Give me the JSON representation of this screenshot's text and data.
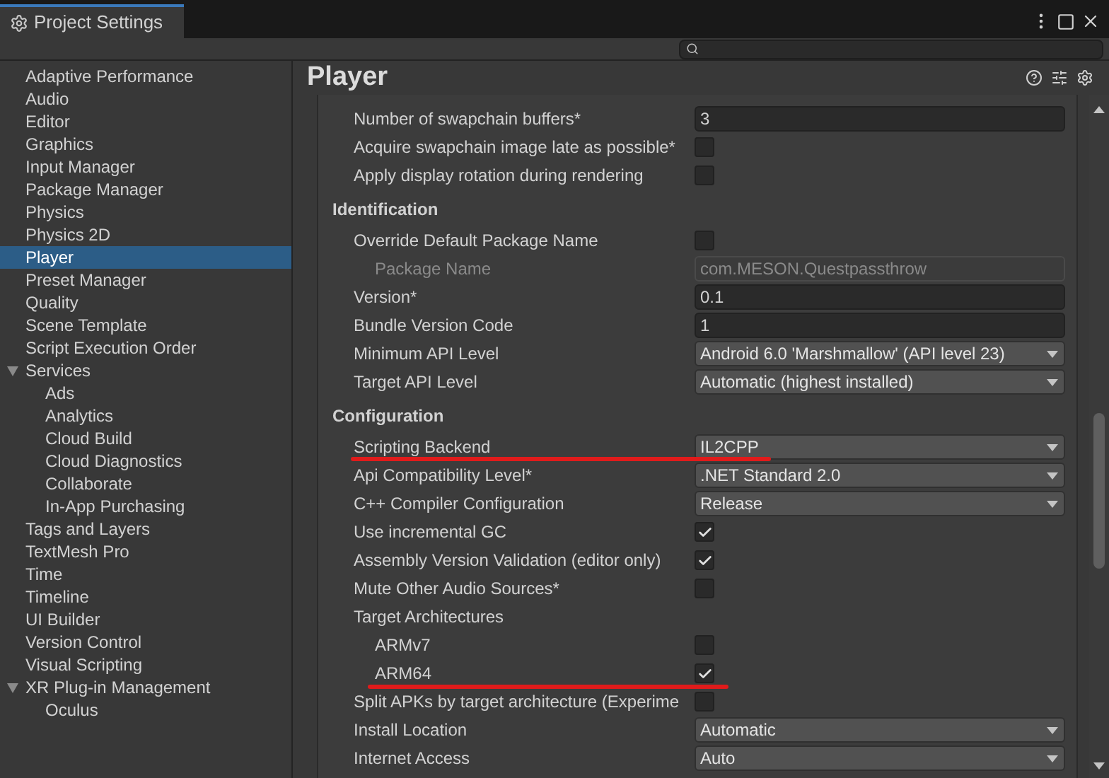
{
  "window": {
    "tab_title": "Project Settings"
  },
  "sidebar": {
    "items": [
      {
        "label": "Adaptive Performance",
        "selected": false
      },
      {
        "label": "Audio",
        "selected": false
      },
      {
        "label": "Editor",
        "selected": false
      },
      {
        "label": "Graphics",
        "selected": false
      },
      {
        "label": "Input Manager",
        "selected": false
      },
      {
        "label": "Package Manager",
        "selected": false
      },
      {
        "label": "Physics",
        "selected": false
      },
      {
        "label": "Physics 2D",
        "selected": false
      },
      {
        "label": "Player",
        "selected": true
      },
      {
        "label": "Preset Manager",
        "selected": false
      },
      {
        "label": "Quality",
        "selected": false
      },
      {
        "label": "Scene Template",
        "selected": false
      },
      {
        "label": "Script Execution Order",
        "selected": false
      },
      {
        "label": "Services",
        "selected": false,
        "expanded": true,
        "children": [
          {
            "label": "Ads",
            "selected": false
          },
          {
            "label": "Analytics",
            "selected": false
          },
          {
            "label": "Cloud Build",
            "selected": false
          },
          {
            "label": "Cloud Diagnostics",
            "selected": false
          },
          {
            "label": "Collaborate",
            "selected": false
          },
          {
            "label": "In-App Purchasing",
            "selected": false
          }
        ]
      },
      {
        "label": "Tags and Layers",
        "selected": false
      },
      {
        "label": "TextMesh Pro",
        "selected": false
      },
      {
        "label": "Time",
        "selected": false
      },
      {
        "label": "Timeline",
        "selected": false
      },
      {
        "label": "UI Builder",
        "selected": false
      },
      {
        "label": "Version Control",
        "selected": false
      },
      {
        "label": "Visual Scripting",
        "selected": false
      },
      {
        "label": "XR Plug-in Management",
        "selected": false,
        "expanded": true,
        "children": [
          {
            "label": "Oculus",
            "selected": false
          }
        ]
      }
    ]
  },
  "panel": {
    "title": "Player",
    "rows": [
      {
        "kind": "field",
        "label": "Number of swapchain buffers*",
        "value": "3",
        "disabled": false
      },
      {
        "kind": "checkbox",
        "label": "Acquire swapchain image late as possible*",
        "checked": false
      },
      {
        "kind": "checkbox",
        "label": "Apply display rotation during rendering",
        "checked": false
      },
      {
        "kind": "header",
        "label": "Identification"
      },
      {
        "kind": "checkbox",
        "label": "Override Default Package Name",
        "checked": false,
        "children": [
          {
            "kind": "field",
            "label": "Package Name",
            "value": "com.MESON.Questpassthrow",
            "disabled": true
          }
        ]
      },
      {
        "kind": "field",
        "label": "Version*",
        "value": "0.1",
        "disabled": false
      },
      {
        "kind": "field",
        "label": "Bundle Version Code",
        "value": "1",
        "disabled": false
      },
      {
        "kind": "dropdown",
        "label": "Minimum API Level",
        "value": "Android 6.0 'Marshmallow' (API level 23)"
      },
      {
        "kind": "dropdown",
        "label": "Target API Level",
        "value": "Automatic (highest installed)"
      },
      {
        "kind": "header",
        "label": "Configuration"
      },
      {
        "kind": "dropdown",
        "label": "Scripting Backend",
        "value": "IL2CPP"
      },
      {
        "kind": "dropdown",
        "label": "Api Compatibility Level*",
        "value": ".NET Standard 2.0"
      },
      {
        "kind": "dropdown",
        "label": "C++ Compiler Configuration",
        "value": "Release"
      },
      {
        "kind": "checkbox",
        "label": "Use incremental GC",
        "checked": true
      },
      {
        "kind": "checkbox",
        "label": "Assembly Version Validation (editor only)",
        "checked": true
      },
      {
        "kind": "checkbox",
        "label": "Mute Other Audio Sources*",
        "checked": false
      },
      {
        "kind": "label",
        "label": "Target Architectures",
        "children": [
          {
            "kind": "checkbox",
            "label": "ARMv7",
            "checked": false
          },
          {
            "kind": "checkbox",
            "label": "ARM64",
            "checked": true
          }
        ]
      },
      {
        "kind": "checkbox",
        "label": "Split APKs by target architecture (Experime",
        "checked": false
      },
      {
        "kind": "dropdown",
        "label": "Install Location",
        "value": "Automatic"
      },
      {
        "kind": "dropdown",
        "label": "Internet Access",
        "value": "Auto"
      }
    ]
  }
}
